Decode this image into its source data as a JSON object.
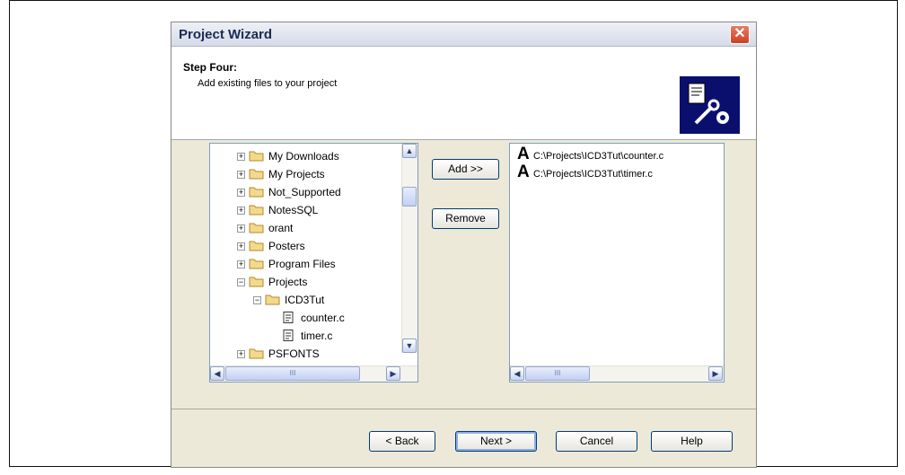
{
  "dialog": {
    "title": "Project Wizard",
    "step_title": "Step Four:",
    "step_description": "Add existing files to your project"
  },
  "tree": {
    "items": [
      {
        "label": "My Downloads",
        "expander": "+",
        "icon": "folder-icon"
      },
      {
        "label": "My Projects",
        "expander": "+",
        "icon": "folder-icon"
      },
      {
        "label": "Not_Supported",
        "expander": "+",
        "icon": "folder-icon"
      },
      {
        "label": "NotesSQL",
        "expander": "+",
        "icon": "folder-icon"
      },
      {
        "label": "orant",
        "expander": "+",
        "icon": "folder-icon"
      },
      {
        "label": "Posters",
        "expander": "+",
        "icon": "folder-icon"
      },
      {
        "label": "Program Files",
        "expander": "+",
        "icon": "folder-icon"
      },
      {
        "label": "Projects",
        "expander": "−",
        "icon": "folder-icon"
      },
      {
        "label": "ICD3Tut",
        "expander": "−",
        "icon": "folder-icon"
      },
      {
        "label": "counter.c",
        "icon": "file-icon"
      },
      {
        "label": "timer.c",
        "icon": "file-icon"
      },
      {
        "label": "PSFONTS",
        "expander": "+",
        "icon": "folder-icon"
      }
    ]
  },
  "buttons": {
    "add": "Add >>",
    "remove": "Remove",
    "back": "< Back",
    "next": "Next >",
    "cancel": "Cancel",
    "help": "Help"
  },
  "added_files": [
    {
      "icon": "A",
      "path": "C:\\Projects\\ICD3Tut\\counter.c"
    },
    {
      "icon": "A",
      "path": "C:\\Projects\\ICD3Tut\\timer.c"
    }
  ],
  "scrollbar": {
    "thumb_grip": "III"
  }
}
